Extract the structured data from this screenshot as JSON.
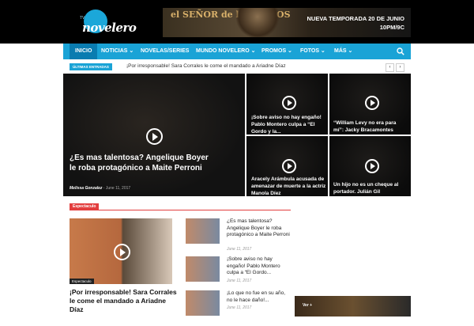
{
  "logo": {
    "text": "novelero",
    "tagline": "TV"
  },
  "banner": {
    "show_title": "el SEÑOR de los CIELOS",
    "line1": "NUEVA TEMPORADA 20 DE JUNIO",
    "line2": "10PM/9C"
  },
  "nav": {
    "items": [
      {
        "label": "INICIO"
      },
      {
        "label": "NOTICIAS ⌄"
      },
      {
        "label": "NOVELAS/SERIES"
      },
      {
        "label": "MUNDO NOVELERO ⌄"
      },
      {
        "label": "PROMOS ⌄"
      },
      {
        "label": "FOTOS ⌄"
      },
      {
        "label": "MÁS ⌄"
      }
    ]
  },
  "ticker": {
    "label": "ÚLTIMAS ENTRADAS",
    "text": "¡Por irresponsable! Sara Corrales le come el mandado a Ariadne Díaz",
    "prev": "‹",
    "next": "›"
  },
  "hero": {
    "title": "¿Es mas talentosa? Angelique Boyer le roba protagónico a Maite Perroni",
    "author": "Melissa Gonzalez",
    "date": "June 11, 2017"
  },
  "tiles": [
    {
      "title": "¡Sobre aviso no hay engaño! Pablo Montero culpa a “El Gordo y la..."
    },
    {
      "title": "“William Levy no era para mí”: Jacky Bracamontes"
    },
    {
      "title": "Aracely Arámbula acusada de amenazar de muerte a la actriz Manola Díez"
    },
    {
      "title": "Un hijo no es un cheque al portador. Julián Gil"
    }
  ],
  "section": {
    "category": "Espectaculo",
    "feature": {
      "overlay": "Espectaculo",
      "title": "¡Por irresponsable! Sara Corrales le come el mandado a Ariadne Díaz"
    },
    "side": [
      {
        "title": "¿Es mas talentosa? Angelique Boyer le roba protagónico a Maite Perroni",
        "date": "June 11, 2017"
      },
      {
        "title": "¡Sobre aviso no hay engaño! Pablo Montero culpa a “El Gordo...",
        "date": "June 11, 2017"
      },
      {
        "title": "¡Lo que no fue en su año, no le hace daño!...",
        "date": "June 11, 2017"
      }
    ]
  },
  "promo": {
    "label": "Ver +"
  }
}
